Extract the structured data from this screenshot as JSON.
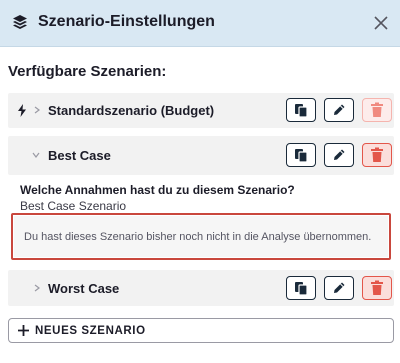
{
  "header": {
    "title": "Szenario-Einstellungen",
    "icon": "layers-icon",
    "close_icon": "close-icon"
  },
  "section_title": "Verfügbare Szenarien:",
  "scenarios": [
    {
      "label": "Standardszenario (Budget)",
      "lead_icon": "lightning-icon",
      "expanded": false,
      "delete_disabled": true
    },
    {
      "label": "Best Case",
      "expanded": true,
      "question": "Welche Annahmen hast du zu diesem Szenario?",
      "answer": "Best Case Szenario",
      "notice": "Du hast dieses Szenario bisher noch nicht in die Analyse übernommen.",
      "delete_disabled": false
    },
    {
      "label": "Worst Case",
      "expanded": false,
      "delete_disabled": false
    }
  ],
  "new_scenario_label": "NEUES SZENARIO",
  "colors": {
    "header_bg": "#d9e8f3",
    "delete_accent": "#e3564a",
    "notice_border": "#c9473d",
    "card_bg": "#f2f2f2"
  }
}
